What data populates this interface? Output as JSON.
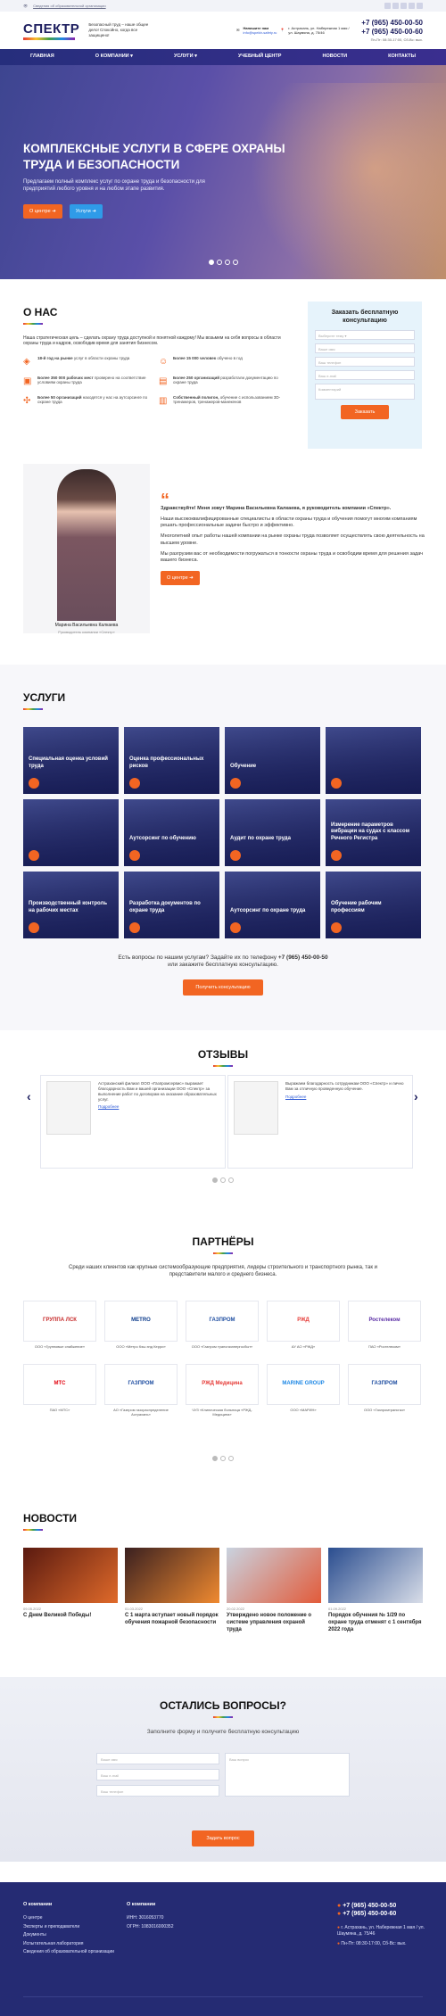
{
  "topbar": {
    "link": "Сведения об образовательной организации"
  },
  "header": {
    "logo": "СПЕКТР",
    "tagline": "Безопасный труд – наше общее дело! Спокойно, когда все защищено!",
    "phone_label": "Напишите нам",
    "email": "info@spektr-safety.ru",
    "address": "г. Астрахань, ул. Набережная 1 мая / ул. Шаумяна, д. 75/46",
    "phone1": "+7 (965) 450-00-50",
    "phone2": "+7 (965) 450-00-60",
    "hours": "Пн-Пт: 08:30-17:00, Сб-Вс: вых."
  },
  "nav": [
    "Главная",
    "О компании",
    "Услуги",
    "Учебный центр",
    "Новости",
    "Контакты"
  ],
  "hero": {
    "title": "Комплексные услуги в сфере охраны труда и безопасности",
    "text": "Предлагаем полный комплекс услуг по охране труда и безопасности для предприятий любого уровня и на любом этапе развития.",
    "btn1": "О центре",
    "btn2": "Услуги"
  },
  "about": {
    "title": "О нас",
    "intro": "Наша стратегическая цель – сделать охрану труда доступной и понятной каждому! Мы возьмем на себя вопросы в области охраны труда и кадров, освободив время для занятия бизнесом.",
    "features": [
      {
        "bold": "18-й год на рынке",
        "text": "услуг в области охраны труда"
      },
      {
        "bold": "Более 15 000 человек",
        "text": "обучено в год"
      },
      {
        "bold": "Более 350 000 рабочих мест",
        "text": "проверено на соответствие условиям охраны труда"
      },
      {
        "bold": "Более 250 организаций",
        "text": "разработали документацию по охране труда"
      },
      {
        "bold": "Более 50 организаций",
        "text": "находятся у нас на аутсорсинге по охране труда"
      },
      {
        "bold": "Собственный полигон,",
        "text": "обучение с использованием 3D-тренажеров, тренажеров-манекенов"
      }
    ]
  },
  "form": {
    "title": "Заказать бесплатную консультацию",
    "f1": "Выберите тему",
    "f2": "Ваше имя",
    "f3": "Ваш телефон",
    "f4": "Ваш e-mail",
    "f5": "Комментарий",
    "btn": "Заказать"
  },
  "director": {
    "name": "Марина Васильевна Калкаева",
    "role": "Руководитель компании «Спектр»",
    "greeting": "Здравствуйте! Меня зовут Марина Васильевна Калкаева, я руководитель компании «Спектр».",
    "p1": "Наши высококвалифицированные специалисты в области охраны труда и обучения помогут многим компаниям решать профессиональные задачи быстро и эффективно.",
    "p2": "Многолетний опыт работы нашей компании на рынке охраны труда позволяет осуществлять свою деятельность на высшем уровне.",
    "p3": "Мы разгрузим вас от необходимости погружаться в тонкости охраны труда и освободим время для решения задач вашего бизнеса.",
    "btn": "О центре"
  },
  "services": {
    "title": "Услуги",
    "items": [
      "Специальная оценка условий труда",
      "Оценка профессиональных рисков",
      "Обучение",
      "",
      "",
      "Аутсорсинг по обучению",
      "Аудит по охране труда",
      "Измерение параметров вибрации на судах с классом Речного Регистра",
      "Производственный контроль на рабочих местах",
      "Разработка документов по охране труда",
      "Аутсорсинг по охране труда",
      "Обучение рабочим профессиям"
    ],
    "ask": "Есть вопросы по нашим услугам? Задайте их по телефону",
    "ask_phone": "+7 (965) 450-00-50",
    "ask2": "или закажите бесплатную консультацию.",
    "btn": "Получить консультацию"
  },
  "reviews": {
    "title": "Отзывы",
    "r1": "Астраханский филиал ООО «Газпромсервис» выражает благодарность Вам и вашей организации ООО «Спектр» за выполнение работ по договорам на оказание образовательных услуг.",
    "r2": "Выражаем благодарность сотрудникам ООО «Спектр» и лично Вам за отличную проведенную обучение.",
    "more": "Подробнее"
  },
  "partners": {
    "title": "Партнёры",
    "text": "Среди наших клиентов как крупные системообразующие предприятия, лидеры строительного и транспортного рынка, так и представители малого и среднего бизнеса.",
    "items": [
      {
        "logo": "ГРУППА ЛСК",
        "name": "ООО «Групповые снабжение»"
      },
      {
        "logo": "METRO",
        "name": "ООО «Метро Кэш энд Керри»"
      },
      {
        "logo": "ГАЗПРОМ",
        "name": "ООО «Газпром трансгазэнергосбыт»"
      },
      {
        "logo": "РЖД",
        "name": "АУ АО «РЖД»"
      },
      {
        "logo": "Ростелеком",
        "name": "ПАО «Ростелеком»"
      },
      {
        "logo": "МТС",
        "name": "ПАО «МТС»"
      },
      {
        "logo": "ГАЗПРОМ",
        "name": "АО «Газпром газораспределение Астрахань»"
      },
      {
        "logo": "РЖД Медицина",
        "name": "ЧУЗ «Клиническая больница «РЖД-Медицина»"
      },
      {
        "logo": "MARINE GROUP",
        "name": "ООО «МАРИН»"
      },
      {
        "logo": "ГАЗПРОМ",
        "name": "ООО «Газпромтрансгаз»"
      }
    ]
  },
  "news": {
    "title": "Новости",
    "items": [
      {
        "date": "09.05.2022",
        "title": "С Днем Великой Победы!"
      },
      {
        "date": "01.03.2022",
        "title": "С 1 марта вступает новый порядок обучения пожарной безопасности"
      },
      {
        "date": "20.02.2022",
        "title": "Утверждено новое положение о системе управления охраной труда"
      },
      {
        "date": "01.09.2022",
        "title": "Порядок обучения № 1/29 по охране труда отменят с 1 сентября 2022 года"
      }
    ]
  },
  "contact": {
    "title": "Остались вопросы?",
    "text": "Заполните форму и получите бесплатную консультацию",
    "f1": "Ваше имя",
    "f2": "Ваш e-mail",
    "f3": "Ваш телефон",
    "f4": "Ваш вопрос",
    "btn": "Задать вопрос"
  },
  "footer": {
    "c1": "О компании",
    "links": [
      "О центре",
      "Эксперты и преподаватели",
      "Документы",
      "Испытательная лаборатория",
      "Сведения об образовательной организации"
    ],
    "c2": "О компании",
    "inn": "ИНН: 3016053770",
    "ogrn": "ОГРН: 1083016000352",
    "p1": "+7 (965) 450-00-50",
    "p2": "+7 (965) 450-00-60",
    "addr": "г. Астрахань, ул. Набережная 1 мая / ул. Шаумяна, д. 75/46",
    "hours": "Пн-Пт: 08:30-17:00, Сб-Вс: вых."
  }
}
